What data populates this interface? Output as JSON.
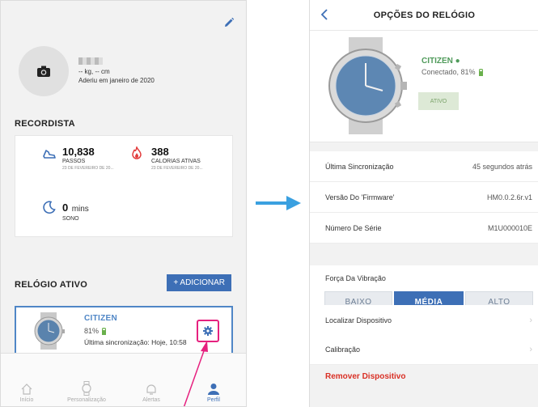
{
  "left": {
    "profile": {
      "stats": "-- kg, -- cm",
      "joined": "Aderiu em janeiro de 2020"
    },
    "records": {
      "title": "RECORDISTA",
      "steps": {
        "value": "10,838",
        "label": "PASSOS",
        "date": "23 DE FEVEREIRO DE 20..."
      },
      "calories": {
        "value": "388",
        "label": "CALORIAS ATIVAS",
        "date": "23 DE FEVEREIRO DE 20..."
      },
      "sleep": {
        "value": "0",
        "unit": "mins",
        "label": "SONO"
      }
    },
    "active_watch": {
      "title": "RELÓGIO ATIVO",
      "add_label": "+ ADICIONAR",
      "brand": "CITIZEN",
      "battery": "81%",
      "sync": "Última sincronização: Hoje, 10:58"
    },
    "tabs": [
      {
        "label": "Início"
      },
      {
        "label": "Personalização"
      },
      {
        "label": "Alertas"
      },
      {
        "label": "Perfil"
      }
    ]
  },
  "right": {
    "title": "OPÇÕES DO RELÓGIO",
    "brand": "CITIZEN ●",
    "status": "Conectado, 81%",
    "badge": "ATIVO",
    "rows": [
      {
        "key": "Última Sincronização",
        "value": "45 segundos atrás"
      },
      {
        "key": "Versão Do 'Firmware'",
        "value": "HM0.0.2.6r.v1"
      },
      {
        "key": "Número De Série",
        "value": "M1U000010E"
      }
    ],
    "vibration": {
      "label": "Força Da Vibração",
      "options": [
        "BAIXO",
        "MÉDIA",
        "ALTO"
      ],
      "selected": "MÉDIA"
    },
    "actions": [
      {
        "label": "Localizar Dispositivo"
      },
      {
        "label": "Calibração"
      }
    ],
    "remove_label": "Remover Dispositivo"
  },
  "colors": {
    "accent": "#3d6fb6",
    "brand_blue": "#4f86c6",
    "highlight": "#e6217f",
    "connected_green": "#4f9a5a",
    "danger": "#d93025"
  }
}
